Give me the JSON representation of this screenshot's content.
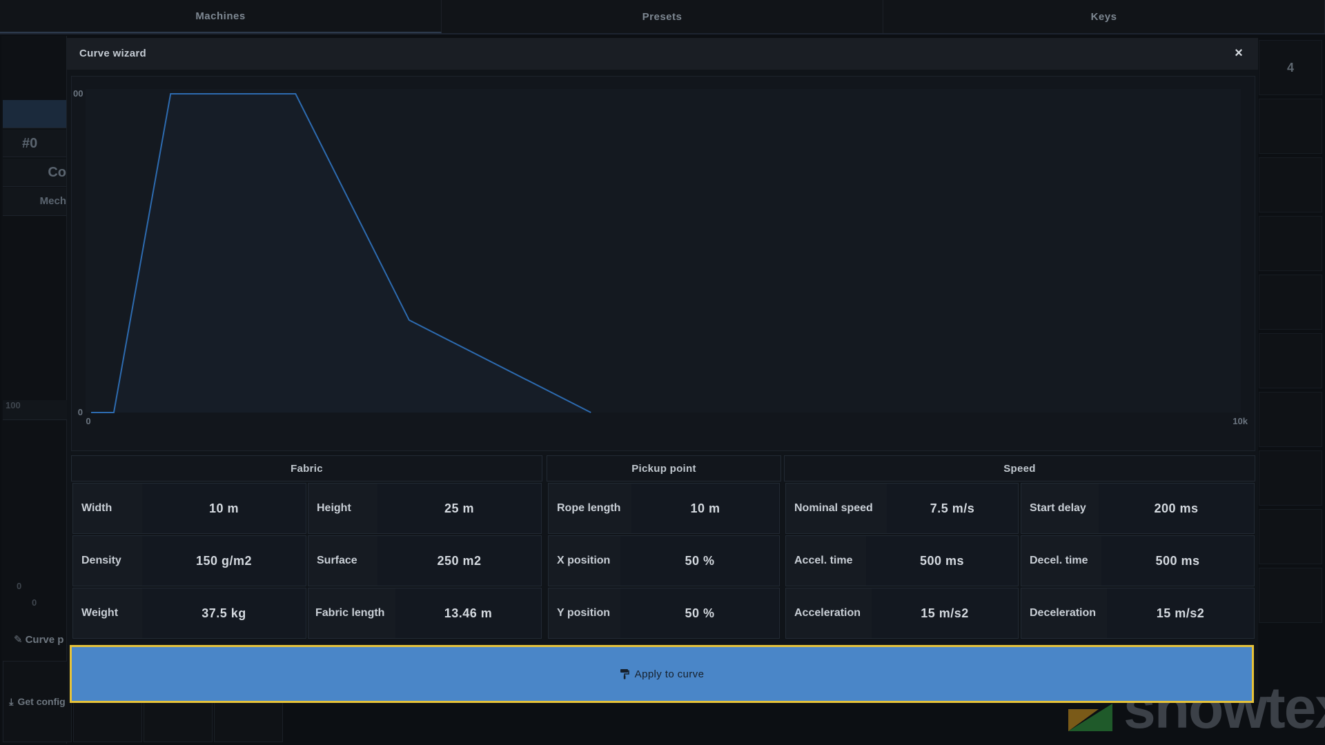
{
  "top_tabs": [
    "Machines",
    "Presets",
    "Keys"
  ],
  "background": {
    "left_id": "#0",
    "left_co": "Co",
    "left_mech": "Mech",
    "left_scale_top": "100",
    "left_scale_bottom": "0",
    "left_scale_x0": "0",
    "right_top": "4",
    "curve_stub": "Curve p",
    "get_config": "Get config",
    "logo_text": "showtex"
  },
  "modal": {
    "title": "Curve wizard",
    "close": "×",
    "apply_label": "Apply to curve",
    "groups": {
      "fabric": {
        "title": "Fabric",
        "fields": [
          {
            "label": "Width",
            "value": "10 m"
          },
          {
            "label": "Height",
            "value": "25 m"
          },
          {
            "label": "Density",
            "value": "150 g/m2"
          },
          {
            "label": "Surface",
            "value": "250 m2"
          },
          {
            "label": "Weight",
            "value": "37.5 kg"
          },
          {
            "label": "Fabric length",
            "value": "13.46 m"
          }
        ]
      },
      "pickup": {
        "title": "Pickup point",
        "fields": [
          {
            "label": "Rope length",
            "value": "10 m"
          },
          {
            "label": "X position",
            "value": "50 %"
          },
          {
            "label": "Y position",
            "value": "50 %"
          }
        ]
      },
      "speed": {
        "title": "Speed",
        "fields": [
          {
            "label": "Nominal speed",
            "value": "7.5 m/s"
          },
          {
            "label": "Start delay",
            "value": "200 ms"
          },
          {
            "label": "Accel. time",
            "value": "500 ms"
          },
          {
            "label": "Decel. time",
            "value": "500 ms"
          },
          {
            "label": "Acceleration",
            "value": "15 m/s2"
          },
          {
            "label": "Deceleration",
            "value": "15 m/s2"
          }
        ]
      }
    }
  },
  "chart_data": {
    "type": "area",
    "title": "",
    "xlabel": "",
    "ylabel": "",
    "x_tick_labels": [
      "0",
      "10k"
    ],
    "y_tick_labels": [
      "0",
      "00"
    ],
    "xlim": [
      0,
      10000
    ],
    "ylim": [
      0,
      100
    ],
    "series": [
      {
        "x": [
          0,
          200,
          700,
          1800,
          2800,
          4400
        ],
        "y": [
          0,
          0,
          100,
          100,
          29,
          0
        ]
      }
    ],
    "colors": {
      "line": "#2d6bb0",
      "fill": "#161d27"
    }
  }
}
